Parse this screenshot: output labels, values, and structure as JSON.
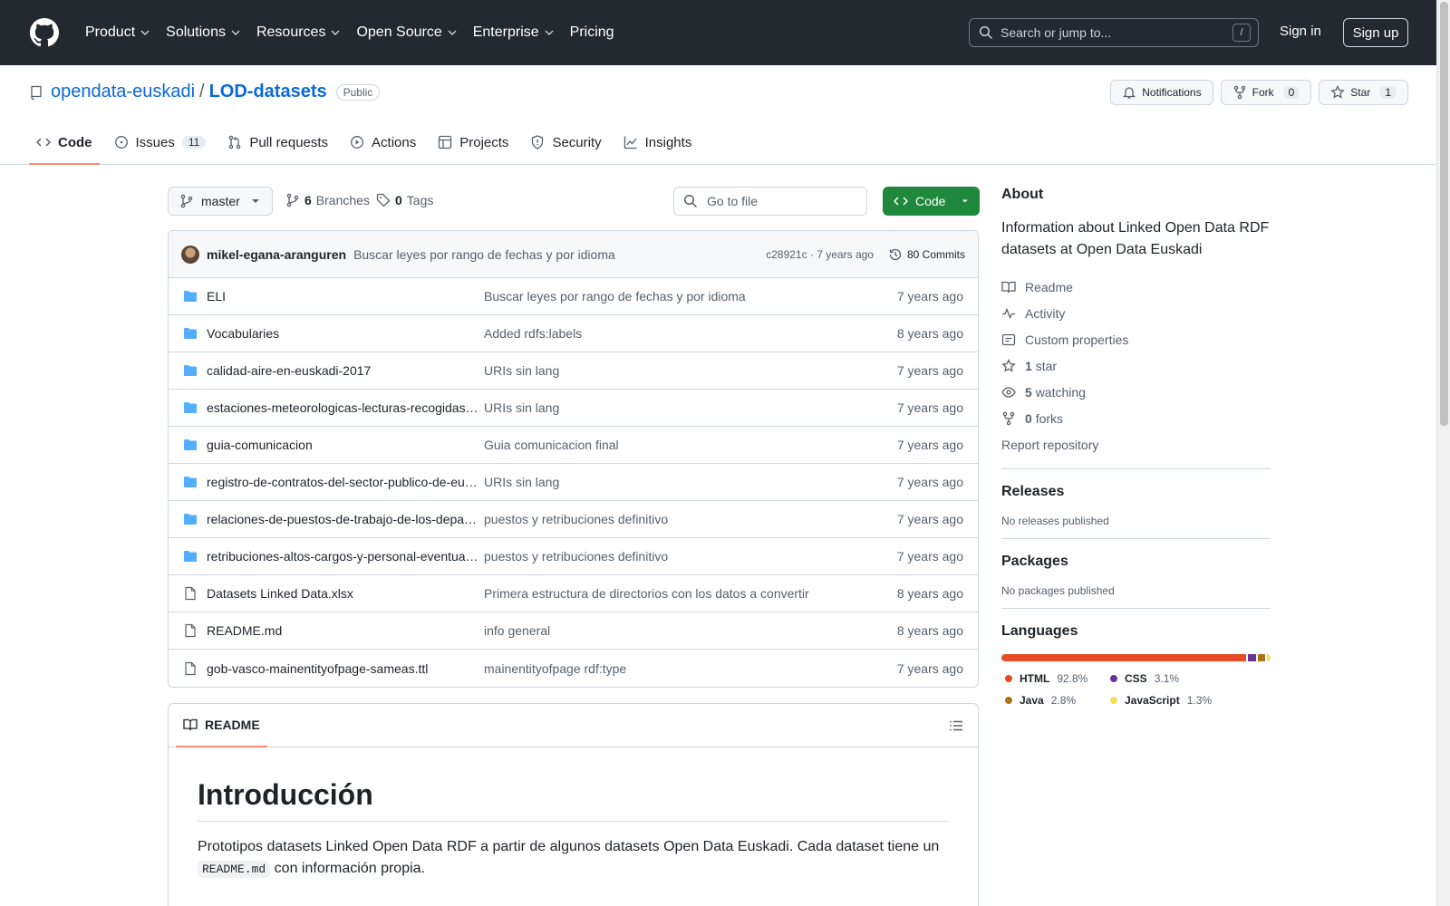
{
  "header": {
    "nav": [
      "Product",
      "Solutions",
      "Resources",
      "Open Source",
      "Enterprise",
      "Pricing"
    ],
    "search_placeholder": "Search or jump to...",
    "search_key": "/",
    "sign_in": "Sign in",
    "sign_up": "Sign up"
  },
  "repo": {
    "owner": "opendata-euskadi",
    "separator": "/",
    "name": "LOD-datasets",
    "visibility": "Public",
    "notifications_label": "Notifications",
    "fork_label": "Fork",
    "fork_count": "0",
    "star_label": "Star",
    "star_count": "1"
  },
  "tabs": [
    {
      "label": "Code",
      "icon": "code-icon"
    },
    {
      "label": "Issues",
      "count": "11",
      "icon": "issue-icon"
    },
    {
      "label": "Pull requests",
      "icon": "pull-request-icon"
    },
    {
      "label": "Actions",
      "icon": "play-icon"
    },
    {
      "label": "Projects",
      "icon": "table-icon"
    },
    {
      "label": "Security",
      "icon": "shield-icon"
    },
    {
      "label": "Insights",
      "icon": "graph-icon"
    }
  ],
  "branch_bar": {
    "branch": "master",
    "branches_count": "6",
    "branches_label": "Branches",
    "tags_count": "0",
    "tags_label": "Tags",
    "goto_placeholder": "Go to file",
    "code_button": "Code"
  },
  "latest_commit": {
    "author": "mikel-egana-aranguren",
    "message": "Buscar leyes por rango de fechas y por idioma",
    "hash_time": "c28921c · 7 years ago",
    "commits": "80 Commits"
  },
  "files": [
    {
      "name": "ELI",
      "type": "dir",
      "message": "Buscar leyes por rango de fechas y por idioma",
      "time": "7 years ago"
    },
    {
      "name": "Vocabularies",
      "type": "dir",
      "message": "Added rdfs:labels",
      "time": "8 years ago"
    },
    {
      "name": "calidad-aire-en-euskadi-2017",
      "type": "dir",
      "message": "URIs sin lang",
      "time": "7 years ago"
    },
    {
      "name": "estaciones-meteorologicas-lecturas-recogidas…",
      "type": "dir",
      "message": "URIs sin lang",
      "time": "7 years ago"
    },
    {
      "name": "guia-comunicacion",
      "type": "dir",
      "message": "Guia comunicacion final",
      "time": "7 years ago"
    },
    {
      "name": "registro-de-contratos-del-sector-publico-de-eu…",
      "type": "dir",
      "message": "URIs sin lang",
      "time": "7 years ago"
    },
    {
      "name": "relaciones-de-puestos-de-trabajo-de-los-depa…",
      "type": "dir",
      "message": "puestos y retribuciones definitivo",
      "time": "7 years ago"
    },
    {
      "name": "retribuciones-altos-cargos-y-personal-eventua…",
      "type": "dir",
      "message": "puestos y retribuciones definitivo",
      "time": "7 years ago"
    },
    {
      "name": "Datasets Linked Data.xlsx",
      "type": "file",
      "message": "Primera estructura de directorios con los datos a convertir",
      "time": "8 years ago"
    },
    {
      "name": "README.md",
      "type": "file",
      "message": "info general",
      "time": "8 years ago"
    },
    {
      "name": "gob-vasco-mainentityofpage-sameas.ttl",
      "type": "file",
      "message": "mainentityofpage rdf:type",
      "time": "7 years ago"
    }
  ],
  "readme": {
    "tab": "README",
    "heading": "Introducción",
    "paragraph_before": "Prototipos datasets Linked Open Data RDF a partir de algunos datasets Open Data Euskadi. Cada dataset tiene un",
    "code": "README.md",
    "paragraph_after": "con información propia."
  },
  "about": {
    "title": "About",
    "description": "Information about Linked Open Data RDF datasets at Open Data Euskadi",
    "readme": "Readme",
    "activity": "Activity",
    "custom_properties": "Custom properties",
    "stars_count": "1",
    "stars_label": "star",
    "watching_count": "5",
    "watching_label": "watching",
    "forks_count": "0",
    "forks_label": "forks",
    "report": "Report repository"
  },
  "releases": {
    "title": "Releases",
    "empty": "No releases published"
  },
  "packages": {
    "title": "Packages",
    "empty": "No packages published"
  },
  "languages": {
    "title": "Languages",
    "items": [
      {
        "name": "HTML",
        "percent": "92.8%",
        "value": 92.8,
        "color": "#e34c26"
      },
      {
        "name": "CSS",
        "percent": "3.1%",
        "value": 3.1,
        "color": "#663399"
      },
      {
        "name": "Java",
        "percent": "2.8%",
        "value": 2.8,
        "color": "#b07219"
      },
      {
        "name": "JavaScript",
        "percent": "1.3%",
        "value": 1.3,
        "color": "#f1e05a"
      }
    ]
  }
}
